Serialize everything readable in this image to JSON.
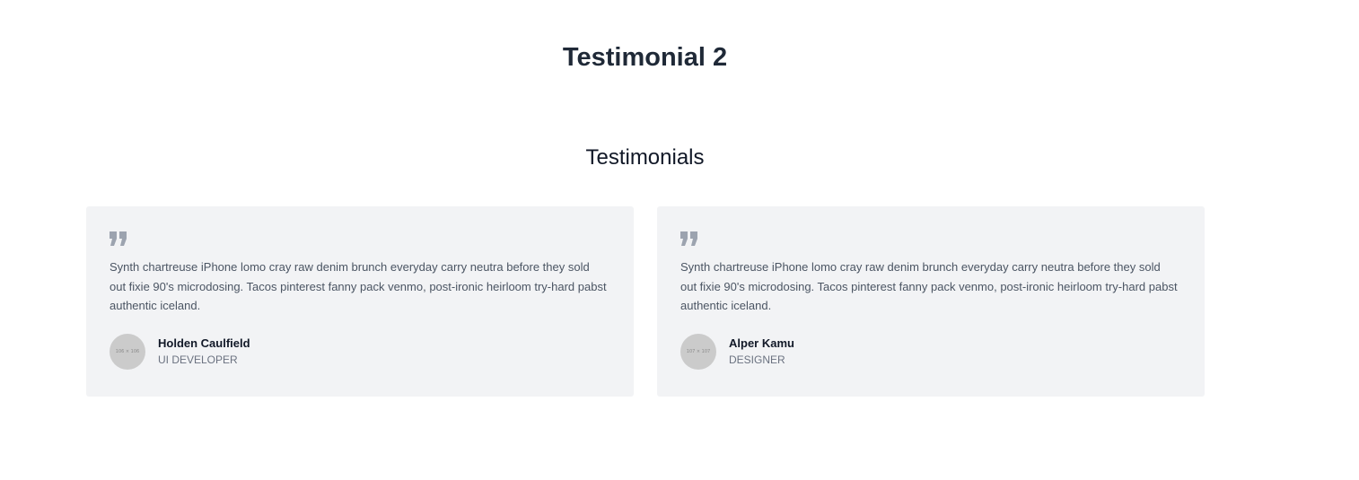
{
  "page": {
    "title": "Testimonial 2"
  },
  "section": {
    "heading": "Testimonials"
  },
  "colors": {
    "card_background": "#f2f3f5",
    "quote_icon": "#9ca3af",
    "avatar_placeholder": "#cbcbcb"
  },
  "testimonials": [
    {
      "icon": "quote-icon",
      "text": "Synth chartreuse iPhone lomo cray raw denim brunch everyday carry neutra before they sold out fixie 90's microdosing. Tacos pinterest fanny pack venmo, post-ironic heirloom try-hard pabst authentic iceland.",
      "avatar_label": "106 × 106",
      "name": "Holden Caulfield",
      "role": "UI DEVELOPER"
    },
    {
      "icon": "quote-icon",
      "text": "Synth chartreuse iPhone lomo cray raw denim brunch everyday carry neutra before they sold out fixie 90's microdosing. Tacos pinterest fanny pack venmo, post-ironic heirloom try-hard pabst authentic iceland.",
      "avatar_label": "107 × 107",
      "name": "Alper Kamu",
      "role": "DESIGNER"
    }
  ]
}
